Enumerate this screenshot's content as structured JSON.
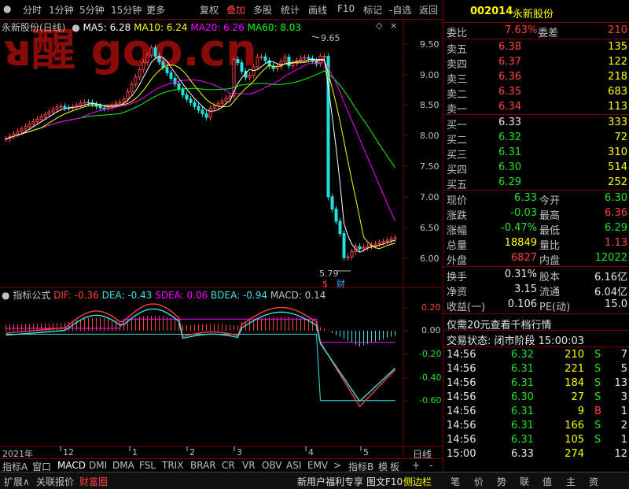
{
  "toolbar": {
    "items": [
      "分时",
      "1分钟",
      "5分钟",
      "15分钟",
      "更多",
      "复权",
      "叠加",
      "多股",
      "统计",
      "画线",
      "F10",
      "标记",
      "-自选",
      "返回"
    ]
  },
  "chart_title": {
    "name": "永新股份(日线)",
    "ma5": "MA5: 6.28",
    "ma10": "MA10: 6.24",
    "ma20": "MA20: 6.26",
    "ma60": "MA60: 8.03"
  },
  "price_axis": [
    "9.50",
    "9.00",
    "8.50",
    "8.00",
    "7.50",
    "7.00",
    "6.50",
    "6.00"
  ],
  "high_marker": "9.65",
  "low_marker": "5.79",
  "event_markers": [
    "$",
    "财"
  ],
  "indicator": {
    "title": "指标公式",
    "dif": "DIF: -0.36",
    "dea": "DEA: -0.43",
    "sdea": "SDEA: 0.06",
    "bdea": "BDEA: -0.94",
    "macd": "MACD: 0.14",
    "axis": [
      "0.20",
      "0.00",
      "-0.20",
      "-0.40",
      "-0.60"
    ]
  },
  "time_axis": {
    "labels": [
      "2021年",
      "12",
      "1",
      "2",
      "3",
      "4",
      "5"
    ],
    "period": "日线"
  },
  "indicator_tabs": [
    "指标A",
    "窗口",
    "MACD",
    "DMI",
    "DMA",
    "FSL",
    "TRIX",
    "BRAR",
    "CR",
    "VR",
    "OBV",
    "ASI",
    "EMV",
    ">",
    "指标B",
    "模",
    "板",
    "+",
    "-"
  ],
  "bottom_bar": {
    "left": [
      "扩展∧",
      "关联报价",
      "财富圈"
    ],
    "right": [
      "新用户福利专享",
      "图文F10",
      "侧边栏"
    ],
    "tabs": [
      "笔",
      "价",
      "势",
      "联",
      "值",
      "主",
      "资"
    ]
  },
  "quote": {
    "code": "002014",
    "name": "永新股份",
    "weibi_label": "委比",
    "weibi": "7.63%",
    "weicha_label": "委差",
    "weicha": "210",
    "asks": [
      {
        "label": "卖五",
        "price": "6.38",
        "vol": "135"
      },
      {
        "label": "卖四",
        "price": "6.37",
        "vol": "122"
      },
      {
        "label": "卖三",
        "price": "6.36",
        "vol": "218"
      },
      {
        "label": "卖二",
        "price": "6.35",
        "vol": "683"
      },
      {
        "label": "卖一",
        "price": "6.34",
        "vol": "113"
      }
    ],
    "bids": [
      {
        "label": "买一",
        "price": "6.33",
        "vol": "333"
      },
      {
        "label": "买二",
        "price": "6.32",
        "vol": "72"
      },
      {
        "label": "买三",
        "price": "6.31",
        "vol": "310"
      },
      {
        "label": "买四",
        "price": "6.30",
        "vol": "514"
      },
      {
        "label": "买五",
        "price": "6.29",
        "vol": "252"
      }
    ],
    "stats": [
      {
        "l1": "现价",
        "v1": "6.33",
        "l2": "今开",
        "v2": "6.30"
      },
      {
        "l1": "涨跌",
        "v1": "-0.03",
        "l2": "最高",
        "v2": "6.36"
      },
      {
        "l1": "涨幅",
        "v1": "-0.47%",
        "l2": "最低",
        "v2": "6.29"
      },
      {
        "l1": "总量",
        "v1": "18849",
        "l2": "量比",
        "v2": "1.13"
      },
      {
        "l1": "外盘",
        "v1": "6827",
        "l2": "内盘",
        "v2": "12022"
      }
    ],
    "stats2": [
      {
        "l1": "换手",
        "v1": "0.31%",
        "l2": "股本",
        "v2": "6.16亿"
      },
      {
        "l1": "净资",
        "v1": "3.15",
        "l2": "流通",
        "v2": "6.04亿"
      },
      {
        "l1": "收益(一)",
        "v1": "0.106",
        "l2": "PE(动)",
        "v2": "15.0"
      }
    ],
    "promo": "仅需20元查看千档行情",
    "status": "交易状态: 闭市阶段 15:00:03",
    "ticks": [
      {
        "t": "14:56",
        "p": "6.32",
        "v": "210",
        "s": "S",
        "n": "7"
      },
      {
        "t": "14:56",
        "p": "6.31",
        "v": "221",
        "s": "S",
        "n": "5"
      },
      {
        "t": "14:56",
        "p": "6.31",
        "v": "184",
        "s": "S",
        "n": "13"
      },
      {
        "t": "14:56",
        "p": "6.30",
        "v": "27",
        "s": "S",
        "n": "3"
      },
      {
        "t": "14:56",
        "p": "6.31",
        "v": "9",
        "s": "B",
        "n": "1"
      },
      {
        "t": "14:56",
        "p": "6.31",
        "v": "166",
        "s": "S",
        "n": "2"
      },
      {
        "t": "14:56",
        "p": "6.31",
        "v": "105",
        "s": "S",
        "n": "1"
      },
      {
        "t": "15:00",
        "p": "6.33",
        "v": "274",
        "s": "",
        "n": "12"
      }
    ]
  },
  "watermark": "ᴚ醒 goo.cn",
  "colors": {
    "bg": "#000000",
    "up": "#ff4040",
    "down": "#20e020",
    "ma5": "#ffffff",
    "ma10": "#ffff00",
    "ma20": "#ff00ff",
    "ma60": "#00ff00",
    "dea": "#40e0e0",
    "grid": "#800000"
  }
}
